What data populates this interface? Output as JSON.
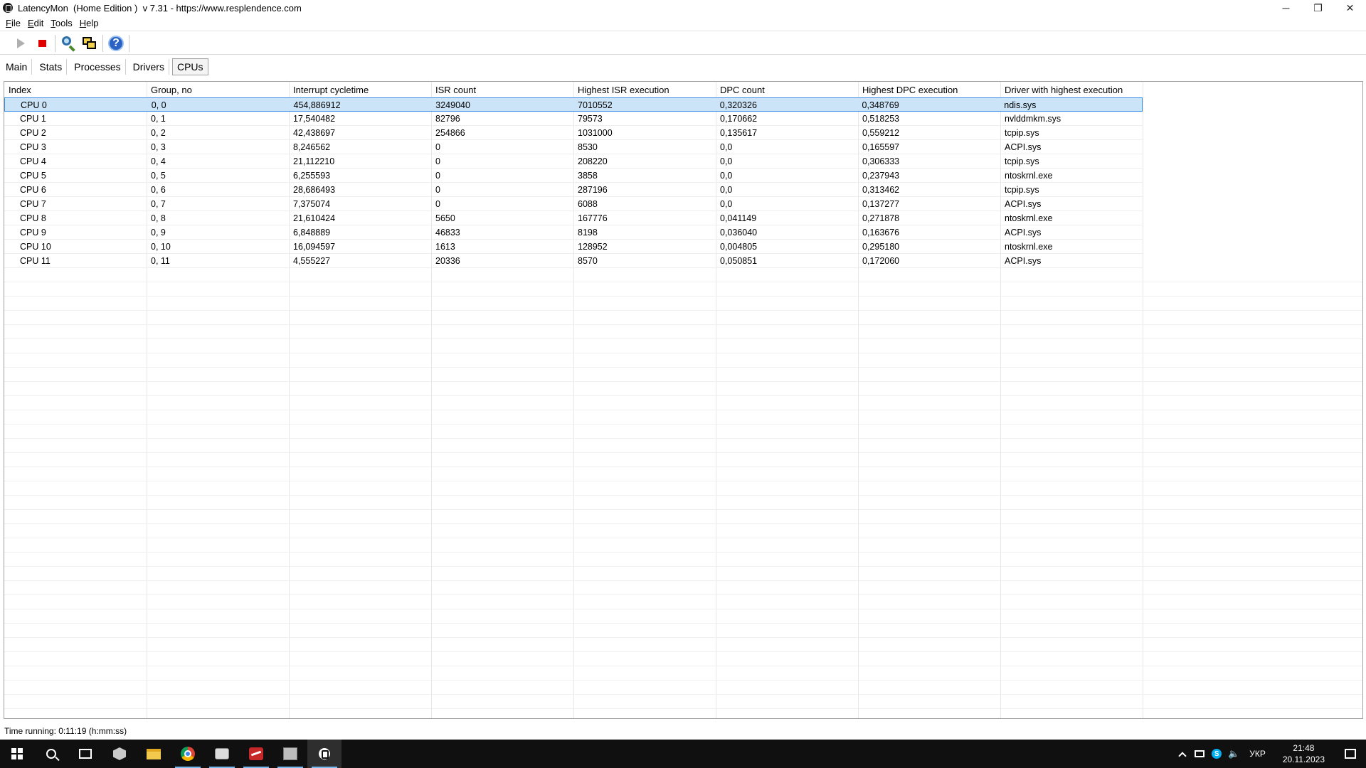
{
  "window": {
    "title": "LatencyMon  (Home Edition )  v 7.31 - https://www.resplendence.com",
    "minimize": "─",
    "restore": "❐",
    "close": "✕"
  },
  "menu": [
    {
      "label": "File"
    },
    {
      "label": "Edit"
    },
    {
      "label": "Tools"
    },
    {
      "label": "Help"
    }
  ],
  "toolbar": {
    "icons": [
      "play-icon",
      "stop-icon",
      "magnify-icon",
      "windows-icon",
      "help-icon"
    ],
    "help_glyph": "?"
  },
  "tabs": [
    {
      "label": "Main",
      "active": false
    },
    {
      "label": "Stats",
      "active": false
    },
    {
      "label": "Processes",
      "active": false
    },
    {
      "label": "Drivers",
      "active": false
    },
    {
      "label": "CPUs",
      "active": true
    }
  ],
  "grid": {
    "columns": [
      "Index",
      "Group, no",
      "Interrupt cycletime",
      "ISR count",
      "Highest ISR execution",
      "DPC count",
      "Highest DPC execution",
      "Driver with highest execution"
    ],
    "rows": [
      [
        "CPU 0",
        "0, 0",
        "454,886912",
        "3249040",
        "7010552",
        "0,320326",
        "0,348769",
        "ndis.sys"
      ],
      [
        "CPU 1",
        "0, 1",
        "17,540482",
        "82796",
        "79573",
        "0,170662",
        "0,518253",
        "nvlddmkm.sys"
      ],
      [
        "CPU 2",
        "0, 2",
        "42,438697",
        "254866",
        "1031000",
        "0,135617",
        "0,559212",
        "tcpip.sys"
      ],
      [
        "CPU 3",
        "0, 3",
        "8,246562",
        "0",
        "8530",
        "0,0",
        "0,165597",
        "ACPI.sys"
      ],
      [
        "CPU 4",
        "0, 4",
        "21,112210",
        "0",
        "208220",
        "0,0",
        "0,306333",
        "tcpip.sys"
      ],
      [
        "CPU 5",
        "0, 5",
        "6,255593",
        "0",
        "3858",
        "0,0",
        "0,237943",
        "ntoskrnl.exe"
      ],
      [
        "CPU 6",
        "0, 6",
        "28,686493",
        "0",
        "287196",
        "0,0",
        "0,313462",
        "tcpip.sys"
      ],
      [
        "CPU 7",
        "0, 7",
        "7,375074",
        "0",
        "6088",
        "0,0",
        "0,137277",
        "ACPI.sys"
      ],
      [
        "CPU 8",
        "0, 8",
        "21,610424",
        "5650",
        "167776",
        "0,041149",
        "0,271878",
        "ntoskrnl.exe"
      ],
      [
        "CPU 9",
        "0, 9",
        "6,848889",
        "46833",
        "8198",
        "0,036040",
        "0,163676",
        "ACPI.sys"
      ],
      [
        "CPU 10",
        "0, 10",
        "16,094597",
        "1613",
        "128952",
        "0,004805",
        "0,295180",
        "ntoskrnl.exe"
      ],
      [
        "CPU 11",
        "0, 11",
        "4,555227",
        "20336",
        "8570",
        "0,050851",
        "0,172060",
        "ACPI.sys"
      ]
    ],
    "selected_row": 0
  },
  "status": {
    "text": "Time running: 0:11:19  (h:mm:ss)"
  },
  "taskbar": {
    "apps": [
      "start-icon",
      "search-icon",
      "task-view-icon",
      "cube-app-icon",
      "file-explorer-icon",
      "chrome-icon",
      "app-gray-icon",
      "app-red-icon",
      "app-box-icon",
      "latencymon-icon"
    ],
    "tray": {
      "language": "УКР",
      "time": "21:48",
      "date": "20.11.2023",
      "volume_glyph": "🔈"
    }
  },
  "colors": {
    "selection": "#cce4f7",
    "selection_border": "#3d8ee0",
    "taskbar": "#101010",
    "stop": "#e00000"
  }
}
